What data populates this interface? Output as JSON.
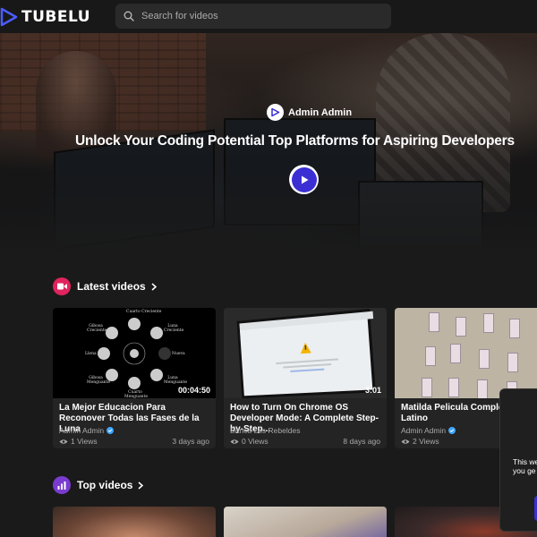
{
  "header": {
    "logo_text": "TUBELU",
    "search_placeholder": "Search for videos"
  },
  "hero": {
    "author": "Admin Admin",
    "title": "Unlock Your Coding Potential Top Platforms for Aspiring Developers"
  },
  "latest": {
    "title": "Latest videos",
    "videos": [
      {
        "title": "La Mejor Educacion Para Reconover Todas las Fases de la Luna",
        "channel": "Admin Admin",
        "verified": true,
        "views": "1 Views",
        "age": "3 days ago",
        "duration": "00:04:50"
      },
      {
        "title": "How to Turn On Chrome OS Developer Mode: A Complete Step-by-Step...",
        "channel": "Banca Los Rebeldes",
        "verified": false,
        "views": "0 Views",
        "age": "8 days ago",
        "duration": "3:01"
      },
      {
        "title": "Matilda Pelicula Completa Español Latino",
        "channel": "Admin Admin",
        "verified": true,
        "views": "2 Views",
        "age": "",
        "duration": ""
      }
    ]
  },
  "moon_labels": {
    "top": "Cuarto Creciente",
    "tl": "Gibosa Creciente",
    "tr": "Luna Creciente",
    "left": "Llena",
    "right": "Nueva",
    "bl": "Gibosa Menguante",
    "br": "Luna Menguante",
    "bottom": "Cuarto Menguante"
  },
  "top": {
    "title": "Top videos"
  },
  "popup": {
    "line1": "This we",
    "line2": "you ge"
  },
  "colors": {
    "accent": "#3b2fd4",
    "latest_icon": "#e0245e",
    "top_icon": "#7a3ccf",
    "verified": "#3ea6ff"
  }
}
